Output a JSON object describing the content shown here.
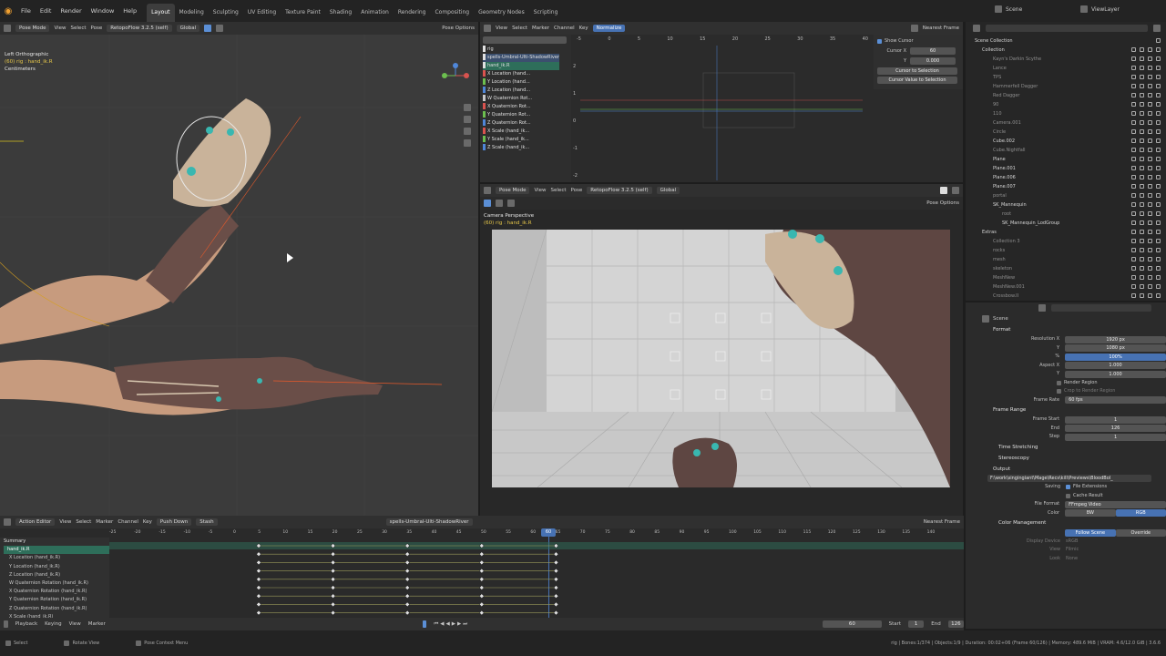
{
  "app": {
    "menus": [
      "File",
      "Edit",
      "Render",
      "Window",
      "Help"
    ],
    "workspaces": [
      "Layout",
      "Modeling",
      "Sculpting",
      "UV Editing",
      "Texture Paint",
      "Shading",
      "Animation",
      "Rendering",
      "Compositing",
      "Geometry Nodes",
      "Scripting"
    ],
    "active_workspace": "Layout",
    "scene_field": "Scene",
    "view_layer_field": "ViewLayer"
  },
  "viewport_left": {
    "mode": "Pose Mode",
    "menus": [
      "View",
      "Select",
      "Pose"
    ],
    "addon": "RetopoFlow 3.2.5 (self)",
    "orientation": "Global",
    "pose_options": "Pose Options",
    "view_name": "Left Orthographic",
    "selection_info": "(60) rig : hand_ik.R",
    "units": "Centimeters"
  },
  "graph_editor": {
    "menus": [
      "View",
      "Select",
      "Marker",
      "Channel",
      "Key"
    ],
    "normalize": "Normalize",
    "interp": "Nearest Frame",
    "frame_ticks": [
      "-5",
      "0",
      "5",
      "10",
      "15",
      "20",
      "25",
      "30",
      "35",
      "40"
    ],
    "value_ticks": [
      "2",
      "1",
      "0",
      "-1",
      "-2"
    ],
    "channels": [
      {
        "name": "rig",
        "color": "#e0e0e0"
      },
      {
        "name": "spells-Umbral-Ulti-ShadowRiver",
        "color": "#e0e0e0"
      },
      {
        "name": "hand_ik.R",
        "color": "#e0e0e0"
      },
      {
        "name": "X Location (hand...",
        "color": "#d9534f"
      },
      {
        "name": "Y Location (hand...",
        "color": "#6cbf4f"
      },
      {
        "name": "Z Location (hand...",
        "color": "#4f87d9"
      },
      {
        "name": "W Quaternion Rot...",
        "color": "#c9c9c9"
      },
      {
        "name": "X Quaternion Rot...",
        "color": "#d9534f"
      },
      {
        "name": "Y Quaternion Rot...",
        "color": "#6cbf4f"
      },
      {
        "name": "Z Quaternion Rot...",
        "color": "#4f87d9"
      },
      {
        "name": "X Scale (hand_ik...",
        "color": "#d9534f"
      },
      {
        "name": "Y Scale (hand_ik...",
        "color": "#6cbf4f"
      },
      {
        "name": "Z Scale (hand_ik...",
        "color": "#4f87d9"
      }
    ],
    "show_cursor": "Show Cursor",
    "cursor_x_label": "Cursor X",
    "cursor_x": "60",
    "cursor_y_label": "Y",
    "cursor_y": "0.000",
    "cursor_to_sel": "Cursor to Selection",
    "cursor_val_to_sel": "Cursor Value to Selection"
  },
  "camera_view": {
    "mode": "Pose Mode",
    "menus": [
      "View",
      "Select",
      "Pose"
    ],
    "addon": "RetopoFlow 3.2.5 (self)",
    "orientation": "Global",
    "pose_options": "Pose Options",
    "view_name": "Camera Perspective",
    "selection_info": "(60) rig : hand_ik.R"
  },
  "outliner": {
    "search_placeholder": "",
    "items": [
      {
        "name": "Scene Collection",
        "dim": false
      },
      {
        "name": "Collection",
        "dim": false
      },
      {
        "name": "Kayn's Darkin Scythe",
        "dim": true
      },
      {
        "name": "Lance",
        "dim": true
      },
      {
        "name": "TPS",
        "dim": true
      },
      {
        "name": "Hammerfell Dagger",
        "dim": true
      },
      {
        "name": "Red Dagger",
        "dim": true
      },
      {
        "name": "90",
        "dim": true
      },
      {
        "name": "110",
        "dim": true
      },
      {
        "name": "Camera.001",
        "dim": true
      },
      {
        "name": "Circle",
        "dim": true
      },
      {
        "name": "Cube.002",
        "dim": false
      },
      {
        "name": "Cube.Nightfall",
        "dim": true
      },
      {
        "name": "Plane",
        "dim": false
      },
      {
        "name": "Plane.001",
        "dim": false
      },
      {
        "name": "Plane.006",
        "dim": false
      },
      {
        "name": "Plane.007",
        "dim": false
      },
      {
        "name": "portal",
        "dim": true
      },
      {
        "name": "SK_Mannequin",
        "dim": false
      },
      {
        "name": "root",
        "dim": true
      },
      {
        "name": "SK_Mannequin_LodGroup",
        "dim": false
      },
      {
        "name": "Extras",
        "dim": false
      },
      {
        "name": "Collection 3",
        "dim": true
      },
      {
        "name": "rocks",
        "dim": true
      },
      {
        "name": "mesh",
        "dim": true
      },
      {
        "name": "skeleton",
        "dim": true
      },
      {
        "name": "MeshNew",
        "dim": true
      },
      {
        "name": "MeshNew.001",
        "dim": true
      },
      {
        "name": "Crossbow.II",
        "dim": true
      }
    ]
  },
  "properties": {
    "context": "Scene",
    "format_label": "Format",
    "res_x_label": "Resolution X",
    "res_x": "1920 px",
    "res_y_label": "Y",
    "res_y": "1080 px",
    "res_pct_label": "%",
    "res_pct": "100%",
    "aspect_x_label": "Aspect X",
    "aspect_x": "1.000",
    "aspect_y_label": "Y",
    "aspect_y": "1.000",
    "render_region": "Render Region",
    "crop_region": "Crop to Render Region",
    "frame_rate_label": "Frame Rate",
    "frame_rate": "60 fps",
    "frame_range_label": "Frame Range",
    "frame_start_label": "Frame Start",
    "frame_start": "1",
    "end_label": "End",
    "end": "126",
    "step_label": "Step",
    "step": "1",
    "time_stretching": "Time Stretching",
    "stereoscopy": "Stereoscopy",
    "output_label": "Output",
    "output_path": "F:\\work\\singingiant\\Mage\\Recs\\kill\\Previews\\BloodBol_",
    "saving_label": "Saving",
    "file_ext": "File Extensions",
    "cache_result": "Cache Result",
    "file_format_label": "File Format",
    "file_format": "FFmpeg Video",
    "color_label": "Color",
    "color_bw": "BW",
    "color_rgb": "RGB",
    "color_mgmt": "Color Management",
    "follow_scene": "Follow Scene",
    "override": "Override",
    "display_device_label": "Display Device",
    "display_device": "sRGB",
    "view_label": "View",
    "view_value": "Filmic",
    "look_label": "Look",
    "look_value": "None"
  },
  "action_editor": {
    "editor_name": "Action Editor",
    "menus": [
      "View",
      "Select",
      "Marker",
      "Channel",
      "Key"
    ],
    "push_down": "Push Down",
    "stash": "Stash",
    "action_name": "spells-Umbral-Ulti-ShadowRiver",
    "interp": "Nearest Frame",
    "frame_ticks": [
      "-25",
      "-20",
      "-15",
      "-10",
      "-5",
      "0",
      "5",
      "10",
      "15",
      "20",
      "25",
      "30",
      "35",
      "40",
      "45",
      "50",
      "55",
      "60",
      "65",
      "70",
      "75",
      "80",
      "85",
      "90",
      "95",
      "100",
      "105",
      "110",
      "115",
      "120",
      "125",
      "130",
      "135",
      "140"
    ],
    "current_frame": "60",
    "channels": [
      "Summary",
      "hand_ik.R",
      "X Location (hand_ik.R)",
      "Y Location (hand_ik.R)",
      "Z Location (hand_ik.R)",
      "W Quaternion Rotation (hand_ik.R)",
      "X Quaternion Rotation (hand_ik.R)",
      "Y Quaternion Rotation (hand_ik.R)",
      "Z Quaternion Rotation (hand_ik.R)",
      "X Scale (hand_ik.R)"
    ]
  },
  "timeline": {
    "menus": [
      "Playback",
      "Keying",
      "View",
      "Marker"
    ],
    "frame": "60",
    "start_label": "Start",
    "start": "1",
    "end_label": "End",
    "end": "126"
  },
  "status": {
    "select": "Select",
    "rotate": "Rotate View",
    "context": "Pose Context Menu",
    "stats": "rig | Bones:1/374 | Objects:1/9 | Duration: 00:02+06 (Frame 60/126) | Memory: 489.6 MiB | VRAM: 4.6/12.0 GiB | 3.6.6"
  }
}
